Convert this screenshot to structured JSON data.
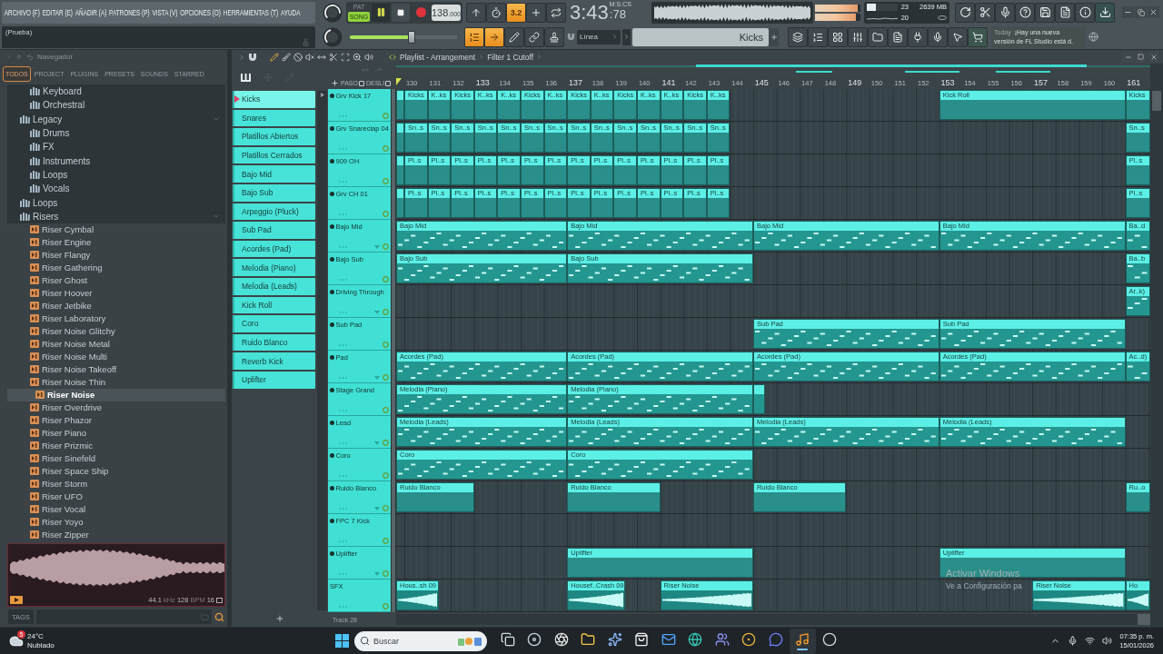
{
  "menu": [
    "ARCHIVO (F)",
    "EDITAR (E)",
    "AÑADIR (A)",
    "PATRONES (P)",
    "VISTA (V)",
    "OPCIONES (O)",
    "HERRAMIENTAS (T)",
    "AYUDA"
  ],
  "hint": "(Prueba)",
  "transport": {
    "modes": [
      {
        "label": "PAT",
        "selected": false
      },
      {
        "label": "SONG",
        "selected": true
      }
    ],
    "playing": true,
    "tempo": "138",
    "tempo_fraction": ".000"
  },
  "toggles_top": [
    {
      "on": false
    },
    {
      "on": false
    },
    {
      "on": true,
      "label": "3.2"
    },
    {
      "on": false
    },
    {
      "on": false
    }
  ],
  "clock": {
    "time": "3:43",
    "centiseconds": ":78",
    "unit": "M:S:CS"
  },
  "meters": [
    {
      "level": 0.93
    },
    {
      "level": 0.9
    }
  ],
  "performance": {
    "level": 0.3,
    "polyphony": "23",
    "memory": "2639 MB",
    "cpu": "20"
  },
  "pitch": {
    "level": 0.58
  },
  "toggles_bottom": [
    {
      "on": true
    },
    {
      "on": true
    },
    {
      "on": false
    },
    {
      "on": false
    },
    {
      "on": false
    }
  ],
  "snap": {
    "value": "Línea"
  },
  "pattern_picker": {
    "value": "Kicks"
  },
  "news": {
    "day": "Today",
    "lines": [
      "¡Hay una nueva",
      "versión de FL Studio está d."
    ]
  },
  "browser": {
    "title": "Navegador",
    "tabs": [
      {
        "label": "TODOS",
        "selected": true
      },
      {
        "label": "PROJECT",
        "selected": false
      },
      {
        "label": "PLUGINS",
        "selected": false
      },
      {
        "label": "PRESETS",
        "selected": false
      },
      {
        "label": "SOUNDS",
        "selected": false
      },
      {
        "label": "STARRED",
        "selected": false
      }
    ],
    "tree": [
      {
        "children": [
          {
            "kind": "folder",
            "label": "Keyboard",
            "expanded": false,
            "selected": false
          },
          {
            "kind": "folder",
            "label": "Orchestral",
            "expanded": false,
            "selected": false
          }
        ]
      },
      {
        "kind": "folder",
        "label": "Legacy",
        "expanded": true,
        "selected": false,
        "children": [
          {
            "kind": "folder",
            "label": "Drums",
            "expanded": false,
            "selected": false
          },
          {
            "kind": "folder",
            "label": "FX",
            "expanded": false,
            "selected": false
          },
          {
            "kind": "folder",
            "label": "Instruments",
            "expanded": false,
            "selected": false
          },
          {
            "kind": "folder",
            "label": "Loops",
            "expanded": false,
            "selected": false
          },
          {
            "kind": "folder",
            "label": "Vocals",
            "expanded": false,
            "selected": false
          }
        ]
      },
      {
        "kind": "folder",
        "label": "Loops",
        "expanded": false,
        "selected": false
      },
      {
        "kind": "folder",
        "label": "Risers",
        "expanded": true,
        "selected": false,
        "children": [
          {
            "kind": "file",
            "label": "Riser Cymbal",
            "selected": false
          },
          {
            "kind": "file",
            "label": "Riser Engine",
            "selected": false
          },
          {
            "kind": "file",
            "label": "Riser Flangy",
            "selected": false
          },
          {
            "kind": "file",
            "label": "Riser Gathering",
            "selected": false
          },
          {
            "kind": "file",
            "label": "Riser Ghost",
            "selected": false
          },
          {
            "kind": "file",
            "label": "Riser Hoover",
            "selected": false
          },
          {
            "kind": "file",
            "label": "Riser Jetbike",
            "selected": false
          },
          {
            "kind": "file",
            "label": "Riser Laboratory",
            "selected": false
          },
          {
            "kind": "file",
            "label": "Riser Noise Glitchy",
            "selected": false
          },
          {
            "kind": "file",
            "label": "Riser Noise Metal",
            "selected": false
          },
          {
            "kind": "file",
            "label": "Riser Noise Multi",
            "selected": false
          },
          {
            "kind": "file",
            "label": "Riser Noise Takeoff",
            "selected": false
          },
          {
            "kind": "file",
            "label": "Riser Noise Thin",
            "selected": false
          },
          {
            "kind": "file",
            "label": "Riser Noise",
            "selected": true
          },
          {
            "kind": "file",
            "label": "Riser Overdrive",
            "selected": false
          },
          {
            "kind": "file",
            "label": "Riser Phazor",
            "selected": false
          },
          {
            "kind": "file",
            "label": "Riser Piano",
            "selected": false
          },
          {
            "kind": "file",
            "label": "Riser Prizmic",
            "selected": false
          },
          {
            "kind": "file",
            "label": "Riser Sinefeld",
            "selected": false
          },
          {
            "kind": "file",
            "label": "Riser Space Ship",
            "selected": false
          },
          {
            "kind": "file",
            "label": "Riser Storm",
            "selected": false
          },
          {
            "kind": "file",
            "label": "Riser UFO",
            "selected": false
          },
          {
            "kind": "file",
            "label": "Riser Vocal",
            "selected": false
          },
          {
            "kind": "file",
            "label": "Riser Yoyo",
            "selected": false
          },
          {
            "kind": "file",
            "label": "Riser Zipper",
            "selected": false
          }
        ]
      }
    ],
    "preview": {
      "info": [
        {
          "text": "44.1",
          "dim": false
        },
        {
          "text": "kHz",
          "dim": true
        },
        {
          "text": "128",
          "dim": false
        },
        {
          "text": "BPM",
          "dim": true
        },
        {
          "text": "16",
          "dim": false
        }
      ]
    },
    "tags": {
      "label": "TAGS"
    }
  },
  "playlist": {
    "title": "Playlist - Arrangement",
    "breadcrumb": "Filter 1 Cutoff",
    "snap_options": [
      {
        "label": "PASO",
        "checked": false
      },
      {
        "label": "DESLI",
        "checked": false
      }
    ],
    "patterns": [
      {
        "label": "Kicks",
        "selected": true
      },
      {
        "label": "Snares",
        "selected": false
      },
      {
        "label": "Platillos Abiertos",
        "selected": false
      },
      {
        "label": "Platillos Cerrados",
        "selected": false
      },
      {
        "label": "Bajo Mid",
        "selected": false
      },
      {
        "label": "Bajo Sub",
        "selected": false
      },
      {
        "label": "Arpeggio (Pluck)",
        "selected": false
      },
      {
        "label": "Sub Pad",
        "selected": false
      },
      {
        "label": "Acordes (Pad)",
        "selected": false
      },
      {
        "label": "Melodia (Piano)",
        "selected": false
      },
      {
        "label": "Melodia (Leads)",
        "selected": false
      },
      {
        "label": "Kick Roll",
        "selected": false
      },
      {
        "label": "Coro",
        "selected": false
      },
      {
        "label": "Ruido Blanco",
        "selected": false
      },
      {
        "label": "Reverb Kick",
        "selected": false
      },
      {
        "label": "Uplifter",
        "selected": false
      }
    ],
    "ruler": [
      {
        "label": "130",
        "major": false
      },
      {
        "label": "131",
        "major": false
      },
      {
        "label": "132",
        "major": false
      },
      {
        "label": "133",
        "major": true
      },
      {
        "label": "134",
        "major": false
      },
      {
        "label": "135",
        "major": false
      },
      {
        "label": "136",
        "major": false
      },
      {
        "label": "137",
        "major": true
      },
      {
        "label": "138",
        "major": false
      },
      {
        "label": "139",
        "major": false
      },
      {
        "label": "140",
        "major": false
      },
      {
        "label": "141",
        "major": true
      },
      {
        "label": "142",
        "major": false
      },
      {
        "label": "143",
        "major": false
      },
      {
        "label": "144",
        "major": false
      },
      {
        "label": "145",
        "major": true
      },
      {
        "label": "146",
        "major": false
      },
      {
        "label": "147",
        "major": false
      },
      {
        "label": "148",
        "major": false
      },
      {
        "label": "149",
        "major": true
      },
      {
        "label": "150",
        "major": false
      },
      {
        "label": "151",
        "major": false
      },
      {
        "label": "152",
        "major": false
      },
      {
        "label": "153",
        "major": true
      },
      {
        "label": "154",
        "major": false
      },
      {
        "label": "155",
        "major": false
      },
      {
        "label": "156",
        "major": false
      },
      {
        "label": "157",
        "major": true
      },
      {
        "label": "158",
        "major": false
      },
      {
        "label": "159",
        "major": false
      },
      {
        "label": "160",
        "major": false
      },
      {
        "label": "161",
        "major": true
      }
    ],
    "tracks": [
      {
        "name": "Grv Kick 17",
        "dot": true,
        "fold": false,
        "clips": [
          {
            "kind": "beat"
          },
          {
            "kind": "beat",
            "label": "Kicks"
          },
          {
            "kind": "beat",
            "label": "K..ks"
          },
          {
            "kind": "beat",
            "label": "Kicks"
          },
          {
            "kind": "beat",
            "label": "K..ks"
          },
          {
            "kind": "beat",
            "label": "K..ks"
          },
          {
            "kind": "beat",
            "label": "Kicks"
          },
          {
            "kind": "beat",
            "label": "K..ks"
          },
          {
            "kind": "beat",
            "label": "Kicks"
          },
          {
            "kind": "beat",
            "label": "K..ks"
          },
          {
            "kind": "beat",
            "label": "Kicks"
          },
          {
            "kind": "beat",
            "label": "K..ks"
          },
          {
            "kind": "beat",
            "label": "K..ks"
          },
          {
            "kind": "beat",
            "label": "Kicks"
          },
          {
            "kind": "beat",
            "label": "K..ks"
          },
          {
            "kind": "beat",
            "label": "Kick Roll"
          },
          {
            "kind": "beat",
            "label": "Kicks"
          }
        ]
      },
      {
        "name": "Grv Snareclap 04",
        "dot": true,
        "fold": false,
        "clips": [
          {
            "kind": "beat"
          },
          {
            "kind": "beat",
            "label": "Sn..s"
          },
          {
            "kind": "beat",
            "label": "Sn..s"
          },
          {
            "kind": "beat",
            "label": "Sn..s"
          },
          {
            "kind": "beat",
            "label": "Sn..s"
          },
          {
            "kind": "beat",
            "label": "Sn..s"
          },
          {
            "kind": "beat",
            "label": "Sn..s"
          },
          {
            "kind": "beat",
            "label": "Sn..s"
          },
          {
            "kind": "beat",
            "label": "Sn..s"
          },
          {
            "kind": "beat",
            "label": "Sn..s"
          },
          {
            "kind": "beat",
            "label": "Sn..s"
          },
          {
            "kind": "beat",
            "label": "Sn..s"
          },
          {
            "kind": "beat",
            "label": "Sn..s"
          },
          {
            "kind": "beat",
            "label": "Sn..s"
          },
          {
            "kind": "beat",
            "label": "Sn..s"
          },
          {
            "kind": "beat",
            "label": "Sn..s"
          }
        ]
      },
      {
        "name": "909 OH",
        "dot": true,
        "fold": false,
        "clips": [
          {
            "kind": "beat"
          },
          {
            "kind": "beat",
            "label": "Pl..s"
          },
          {
            "kind": "beat",
            "label": "Pl..s"
          },
          {
            "kind": "beat",
            "label": "Pl..s"
          },
          {
            "kind": "beat",
            "label": "Pl..s"
          },
          {
            "kind": "beat",
            "label": "Pl..s"
          },
          {
            "kind": "beat",
            "label": "Pl..s"
          },
          {
            "kind": "beat",
            "label": "Pl..s"
          },
          {
            "kind": "beat",
            "label": "Pl..s"
          },
          {
            "kind": "beat",
            "label": "Pl..s"
          },
          {
            "kind": "beat",
            "label": "Pl..s"
          },
          {
            "kind": "beat",
            "label": "Pl..s"
          },
          {
            "kind": "beat",
            "label": "Pl..s"
          },
          {
            "kind": "beat",
            "label": "Pl..s"
          },
          {
            "kind": "beat",
            "label": "Pl..s"
          },
          {
            "kind": "beat",
            "label": "Pl..s"
          }
        ]
      },
      {
        "name": "Grv CH 01",
        "dot": true,
        "fold": false,
        "clips": [
          {
            "kind": "beat"
          },
          {
            "kind": "beat",
            "label": "Pl..s"
          },
          {
            "kind": "beat",
            "label": "Pl..s"
          },
          {
            "kind": "beat",
            "label": "Pl..s"
          },
          {
            "kind": "beat",
            "label": "Pl..s"
          },
          {
            "kind": "beat",
            "label": "Pl..s"
          },
          {
            "kind": "beat",
            "label": "Pl..s"
          },
          {
            "kind": "beat",
            "label": "Pl..s"
          },
          {
            "kind": "beat",
            "label": "Pl..s"
          },
          {
            "kind": "beat",
            "label": "Pl..s"
          },
          {
            "kind": "beat",
            "label": "Pl..s"
          },
          {
            "kind": "beat",
            "label": "Pl..s"
          },
          {
            "kind": "beat",
            "label": "Pl..s"
          },
          {
            "kind": "beat",
            "label": "Pl..s"
          },
          {
            "kind": "beat",
            "label": "Pl..s"
          },
          {
            "kind": "beat",
            "label": "Pl..s"
          }
        ]
      },
      {
        "name": "Bajo Mid",
        "dot": true,
        "fold": true,
        "clips": [
          {
            "kind": "notes",
            "label": "Bajo Mid"
          },
          {
            "kind": "notes",
            "label": "Bajo Mid"
          },
          {
            "kind": "notes",
            "label": "Bajo Mid"
          },
          {
            "kind": "notes",
            "label": "Bajo Mid"
          },
          {
            "kind": "notes",
            "label": "Ba..d"
          }
        ]
      },
      {
        "name": "Bajo Sub",
        "dot": true,
        "fold": false,
        "clips": [
          {
            "kind": "notes",
            "label": "Bajo Sub"
          },
          {
            "kind": "notes",
            "label": "Bajo Sub"
          },
          {
            "kind": "notes",
            "label": "Ba..b"
          }
        ]
      },
      {
        "name": "Driving Through",
        "dot": true,
        "fold": true,
        "clips": [
          {
            "kind": "notes",
            "label": "Ar..k)"
          }
        ]
      },
      {
        "name": "Sub Pad",
        "dot": true,
        "fold": false,
        "clips": [
          {
            "kind": "notes",
            "label": "Sub Pad"
          },
          {
            "kind": "notes",
            "label": "Sub Pad"
          }
        ]
      },
      {
        "name": "Pad",
        "dot": true,
        "fold": true,
        "clips": [
          {
            "kind": "notes",
            "label": "Acordes (Pad)"
          },
          {
            "kind": "notes",
            "label": "Acordes (Pad)"
          },
          {
            "kind": "notes",
            "label": "Acordes (Pad)"
          },
          {
            "kind": "notes",
            "label": "Acordes (Pad)"
          },
          {
            "kind": "notes",
            "label": "Ac..d)"
          }
        ]
      },
      {
        "name": "Stage Grand",
        "dot": true,
        "fold": false,
        "clips": [
          {
            "kind": "notes",
            "label": "Melodia (Piano)"
          },
          {
            "kind": "notes",
            "label": "Melodia (Piano)"
          },
          {
            "kind": "notes"
          }
        ]
      },
      {
        "name": "Lead",
        "dot": true,
        "fold": true,
        "clips": [
          {
            "kind": "notes",
            "label": "Melodia (Leads)"
          },
          {
            "kind": "notes",
            "label": "Melodia (Leads)"
          },
          {
            "kind": "notes",
            "label": "Melodia (Leads)"
          },
          {
            "kind": "notes",
            "label": "Melodia (Leads)"
          }
        ]
      },
      {
        "name": "Coro",
        "dot": true,
        "fold": false,
        "clips": [
          {
            "kind": "notes",
            "label": "Coro"
          },
          {
            "kind": "notes",
            "label": "Coro"
          }
        ]
      },
      {
        "name": "Ruido Blanco",
        "dot": true,
        "fold": true,
        "clips": [
          {
            "kind": "beat",
            "label": "Ruido Blanco"
          },
          {
            "kind": "beat",
            "label": "Ruido Blanco"
          },
          {
            "kind": "beat",
            "label": "Ruido Blanco"
          },
          {
            "kind": "beat",
            "label": "Ru..o"
          }
        ]
      },
      {
        "name": "FPC 7 Kick",
        "dot": true,
        "fold": false
      },
      {
        "name": "Uplifter",
        "dot": true,
        "fold": true,
        "clips": [
          {
            "kind": "beat",
            "label": "Uplifter"
          },
          {
            "kind": "beat",
            "label": "Uplifter"
          }
        ]
      },
      {
        "name": "SFX",
        "dot": false,
        "fold": false,
        "clips": [
          {
            "kind": "audio",
            "label": "Hous..sh 09"
          },
          {
            "kind": "audio",
            "label": "Housef..Crash 09"
          },
          {
            "kind": "audio",
            "label": "Riser Noise"
          },
          {
            "kind": "audio",
            "label": "Riser Noise"
          },
          {
            "kind": "audio",
            "label": "Ho"
          }
        ]
      }
    ],
    "next_track": "Track 28"
  },
  "windows_notice": {
    "title": "Activar Windows",
    "text": "Ve a Configuración pa"
  },
  "taskbar": {
    "weather": {
      "badge": "5",
      "temperature": "24°C",
      "condition": "Nublado"
    },
    "search": {
      "placeholder": "Buscar"
    },
    "apps": [
      {
        "active": false
      },
      {
        "active": false
      },
      {
        "active": false
      },
      {
        "active": false
      },
      {
        "active": false
      },
      {
        "active": false
      },
      {
        "active": false
      },
      {
        "active": false
      },
      {
        "active": false
      },
      {
        "active": false
      },
      {
        "active": false
      },
      {
        "active": true
      },
      {
        "active": false
      }
    ],
    "clock": {
      "time": "07:35 p. m.",
      "date": "15/01/2026"
    }
  }
}
